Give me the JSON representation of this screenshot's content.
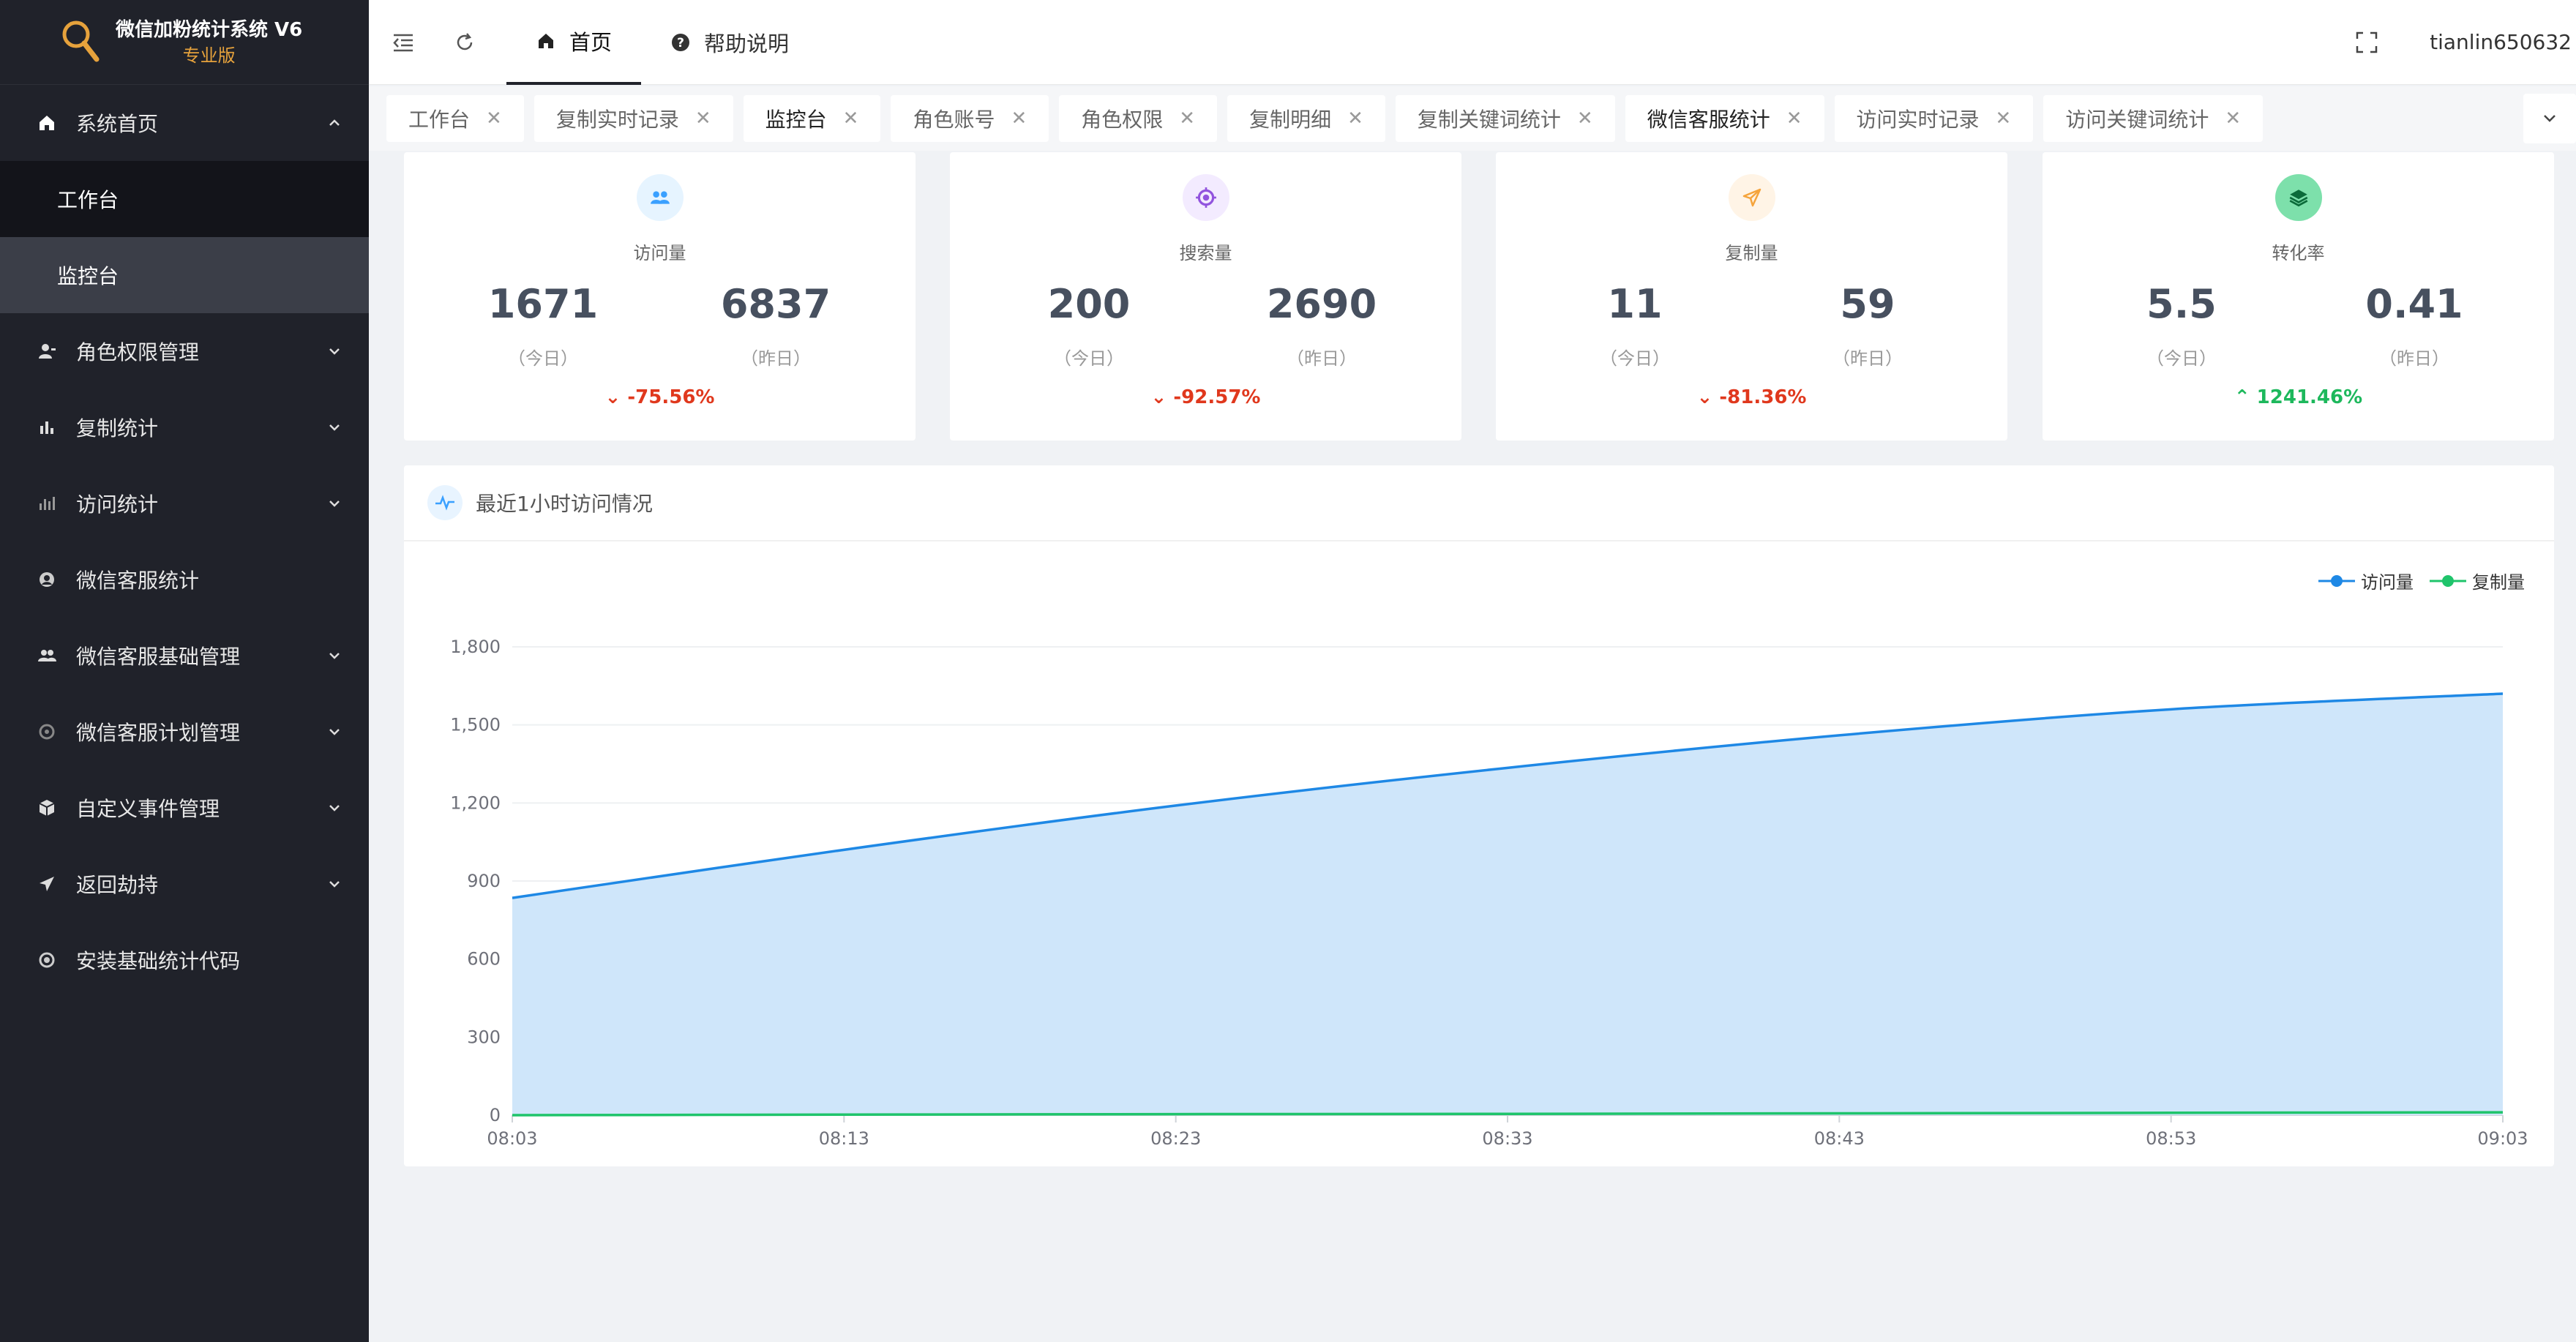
{
  "app": {
    "title": "微信加粉统计系统 V6",
    "edition": "专业版"
  },
  "sidebar": {
    "items": [
      {
        "label": "系统首页",
        "icon": "home-icon",
        "expanded": true,
        "children": [
          {
            "label": "工作台",
            "active": false
          },
          {
            "label": "监控台",
            "active": true
          }
        ]
      },
      {
        "label": "角色权限管理",
        "icon": "user-role-icon",
        "hasArrow": true
      },
      {
        "label": "复制统计",
        "icon": "bar-chart-icon",
        "hasArrow": true
      },
      {
        "label": "访问统计",
        "icon": "stats-icon",
        "hasArrow": true
      },
      {
        "label": "微信客服统计",
        "icon": "service-icon",
        "hasArrow": false
      },
      {
        "label": "微信客服基础管理",
        "icon": "users-icon",
        "hasArrow": true
      },
      {
        "label": "微信客服计划管理",
        "icon": "plan-icon",
        "hasArrow": true
      },
      {
        "label": "自定义事件管理",
        "icon": "cube-icon",
        "hasArrow": true
      },
      {
        "label": "返回劫持",
        "icon": "send-icon",
        "hasArrow": true
      },
      {
        "label": "安装基础统计代码",
        "icon": "target-icon",
        "hasArrow": false
      }
    ]
  },
  "header": {
    "tabs": [
      {
        "label": "首页",
        "icon": "home-icon",
        "active": true
      },
      {
        "label": "帮助说明",
        "icon": "help-icon",
        "active": false
      }
    ],
    "username": "tianlin650632"
  },
  "tags": [
    {
      "label": "工作台",
      "active": false
    },
    {
      "label": "复制实时记录",
      "active": false
    },
    {
      "label": "监控台",
      "active": true
    },
    {
      "label": "角色账号",
      "active": false
    },
    {
      "label": "角色权限",
      "active": false
    },
    {
      "label": "复制明细",
      "active": false
    },
    {
      "label": "复制关键词统计",
      "active": false
    },
    {
      "label": "微信客服统计",
      "active": true
    },
    {
      "label": "访问实时记录",
      "active": false
    },
    {
      "label": "访问关键词统计",
      "active": false
    }
  ],
  "stats": [
    {
      "name": "访问量",
      "today": "1671",
      "yesterday": "6837",
      "today_label": "（今日）",
      "yesterday_label": "（昨日）",
      "change": "-75.56%",
      "trend": "down",
      "icon": "users-icon",
      "color": "#3aa0ff",
      "bg": "#e6f4ff"
    },
    {
      "name": "搜索量",
      "today": "200",
      "yesterday": "2690",
      "today_label": "（今日）",
      "yesterday_label": "（昨日）",
      "change": "-92.57%",
      "trend": "down",
      "icon": "target-icon",
      "color": "#9254de",
      "bg": "#f3ebff"
    },
    {
      "name": "复制量",
      "today": "11",
      "yesterday": "59",
      "today_label": "（今日）",
      "yesterday_label": "（昨日）",
      "change": "-81.36%",
      "trend": "down",
      "icon": "send-icon",
      "color": "#f5a43c",
      "bg": "#fff4e6"
    },
    {
      "name": "转化率",
      "today": "5.5",
      "yesterday": "0.41",
      "today_label": "（今日）",
      "yesterday_label": "（昨日）",
      "change": "1241.46%",
      "trend": "up",
      "icon": "layers-icon",
      "color": "#1bbf73",
      "bg": "#c9f5dd"
    }
  ],
  "panel": {
    "title": "最近1小时访问情况",
    "icon": "pulse-icon"
  },
  "chart_data": {
    "type": "area",
    "x": [
      "08:03",
      "08:13",
      "08:23",
      "08:33",
      "08:43",
      "08:53",
      "09:03"
    ],
    "ylim": [
      0,
      1800
    ],
    "yticks": [
      0,
      300,
      600,
      900,
      1200,
      1500,
      1800
    ],
    "ytick_labels": [
      "0",
      "300",
      "600",
      "900",
      "1,200",
      "1,500",
      "1,800"
    ],
    "legend_position": "top-right",
    "series": [
      {
        "name": "访问量",
        "color": "#1e88e5",
        "fill": "#cfe6fa",
        "values": [
          835,
          1020,
          1190,
          1335,
          1460,
          1560,
          1620
        ]
      },
      {
        "name": "复制量",
        "color": "#1fc46b",
        "values": [
          0,
          2,
          4,
          5,
          7,
          9,
          11
        ]
      }
    ]
  }
}
